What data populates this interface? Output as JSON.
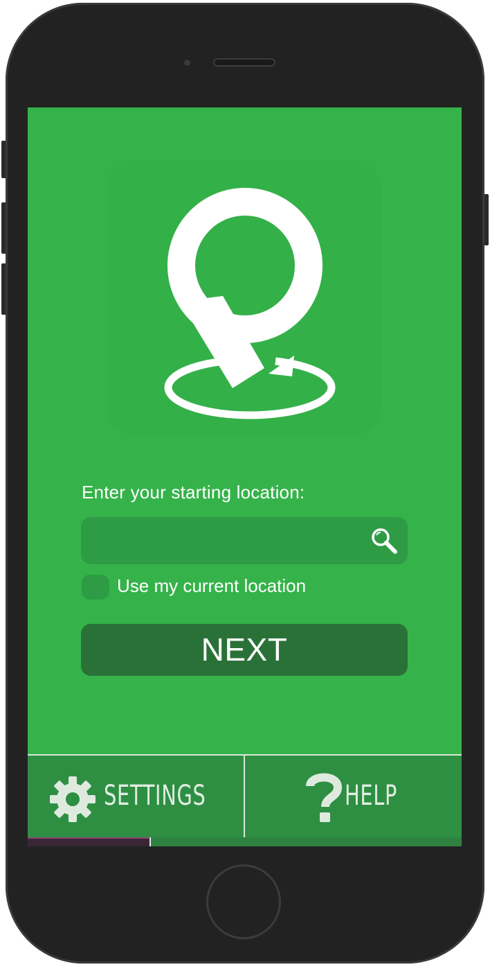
{
  "app": {
    "prompt_label": "Enter your starting location:",
    "search": {
      "value": "",
      "placeholder": "",
      "icon": "search-icon"
    },
    "current_location": {
      "label": "Use my current location",
      "checked": false
    },
    "next_button_label": "NEXT",
    "logo_icon": "map-pin-arrival-icon"
  },
  "tab_bar": {
    "settings": {
      "label": "SETTINGS",
      "icon": "gear-icon"
    },
    "help": {
      "label": "HELP",
      "icon": "question-mark-icon"
    }
  },
  "colors": {
    "screen_background": "#35b34a",
    "field_background": "#2e9b45",
    "next_button": "#2a7138",
    "tab_bar": "#2e8f43",
    "phone_body": "#222222",
    "text": "#ffffff"
  }
}
